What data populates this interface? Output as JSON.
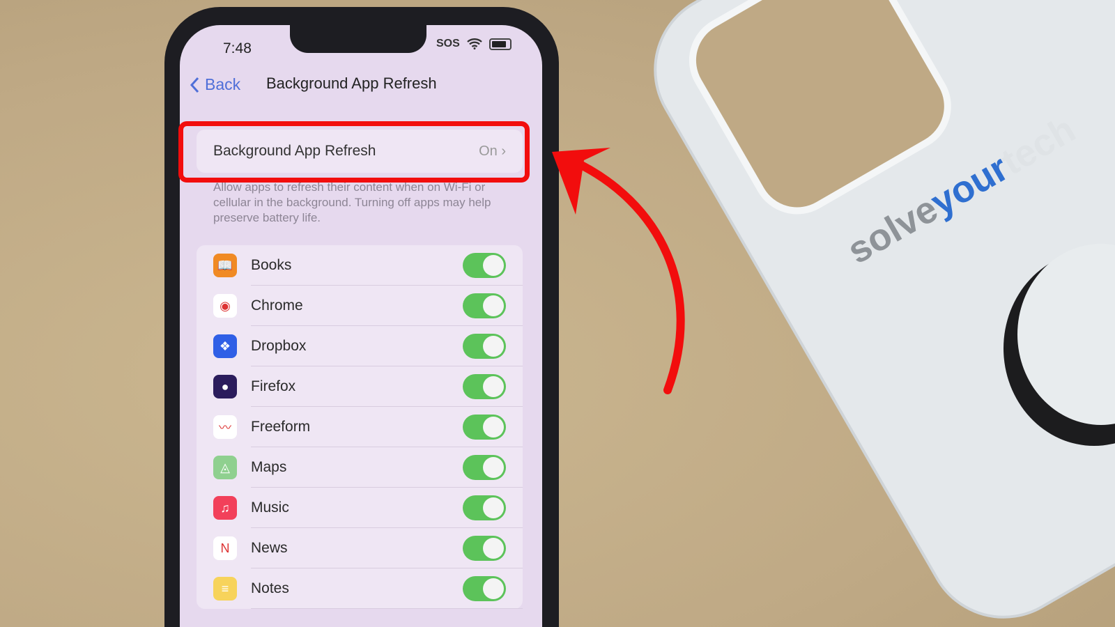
{
  "status_bar": {
    "time": "7:48",
    "carrier": "SOS",
    "wifi_icon": "wifi-icon",
    "battery_icon": "battery-icon"
  },
  "nav": {
    "back_label": "Back",
    "title": "Background App Refresh"
  },
  "main_setting": {
    "label": "Background App Refresh",
    "value": "On"
  },
  "description": "Allow apps to refresh their content when on Wi-Fi or cellular in the background. Turning off apps may help preserve battery life.",
  "apps": [
    {
      "name": "Books",
      "icon": "books-icon",
      "color": "#f08a24",
      "on": true
    },
    {
      "name": "Chrome",
      "icon": "chrome-icon",
      "color": "#ffffff",
      "on": true
    },
    {
      "name": "Dropbox",
      "icon": "dropbox-icon",
      "color": "#2f5fe6",
      "on": true
    },
    {
      "name": "Firefox",
      "icon": "firefox-icon",
      "color": "#2b1c5c",
      "on": true
    },
    {
      "name": "Freeform",
      "icon": "freeform-icon",
      "color": "#ffffff",
      "on": true
    },
    {
      "name": "Maps",
      "icon": "maps-icon",
      "color": "#8fd08f",
      "on": true
    },
    {
      "name": "Music",
      "icon": "music-icon",
      "color": "#f2405a",
      "on": true
    },
    {
      "name": "News",
      "icon": "news-icon",
      "color": "#ffffff",
      "on": true
    },
    {
      "name": "Notes",
      "icon": "notes-icon",
      "color": "#f7d35b",
      "on": true
    }
  ],
  "colors": {
    "toggle_on": "#5cc35a",
    "highlight": "#f20d0d",
    "accent": "#4f6fd8"
  },
  "watermark": {
    "logo": "solveyourtech"
  }
}
